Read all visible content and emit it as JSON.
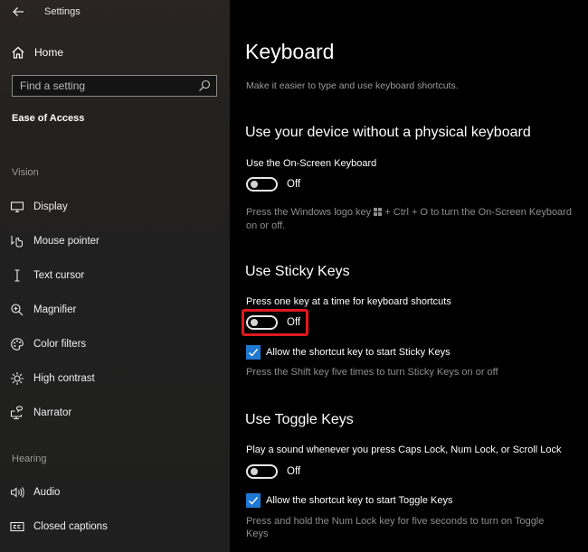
{
  "window": {
    "title": "Settings"
  },
  "sidebar": {
    "home_label": "Home",
    "search": {
      "placeholder": "Find a setting",
      "value": ""
    },
    "section_title": "Ease of Access",
    "groups": [
      {
        "label": "Vision",
        "items": [
          {
            "label": "Display",
            "icon": "display-icon"
          },
          {
            "label": "Mouse pointer",
            "icon": "mouse-pointer-icon"
          },
          {
            "label": "Text cursor",
            "icon": "text-cursor-icon"
          },
          {
            "label": "Magnifier",
            "icon": "magnifier-icon"
          },
          {
            "label": "Color filters",
            "icon": "color-filters-icon"
          },
          {
            "label": "High contrast",
            "icon": "high-contrast-icon"
          },
          {
            "label": "Narrator",
            "icon": "narrator-icon"
          }
        ]
      },
      {
        "label": "Hearing",
        "items": [
          {
            "label": "Audio",
            "icon": "audio-icon"
          },
          {
            "label": "Closed captions",
            "icon": "closed-captions-icon"
          }
        ]
      }
    ]
  },
  "main": {
    "title": "Keyboard",
    "description": "Make it easier to type and use keyboard shortcuts.",
    "sections": [
      {
        "heading": "Use your device without a physical keyboard",
        "option_label": "Use the On-Screen Keyboard",
        "toggle_state": "Off",
        "hint_before_icon": "Press the Windows logo key",
        "hint_after_icon": "+ Ctrl + O to turn the On-Screen Keyboard on or off."
      },
      {
        "heading": "Use Sticky Keys",
        "option_label": "Press one key at a time for keyboard shortcuts",
        "toggle_state": "Off",
        "checkbox_label": "Allow the shortcut key to start Sticky Keys",
        "checkbox_checked": true,
        "hint": "Press the Shift key five times to turn Sticky Keys on or off"
      },
      {
        "heading": "Use Toggle Keys",
        "option_label": "Play a sound whenever you press Caps Lock, Num Lock, or Scroll Lock",
        "toggle_state": "Off",
        "checkbox_label": "Allow the shortcut key to start Toggle Keys",
        "checkbox_checked": true,
        "hint": "Press and hold the Num Lock key for five seconds to turn on Toggle Keys"
      }
    ]
  },
  "colors": {
    "accent": "#1f78d1",
    "highlight": "#e0191f"
  }
}
